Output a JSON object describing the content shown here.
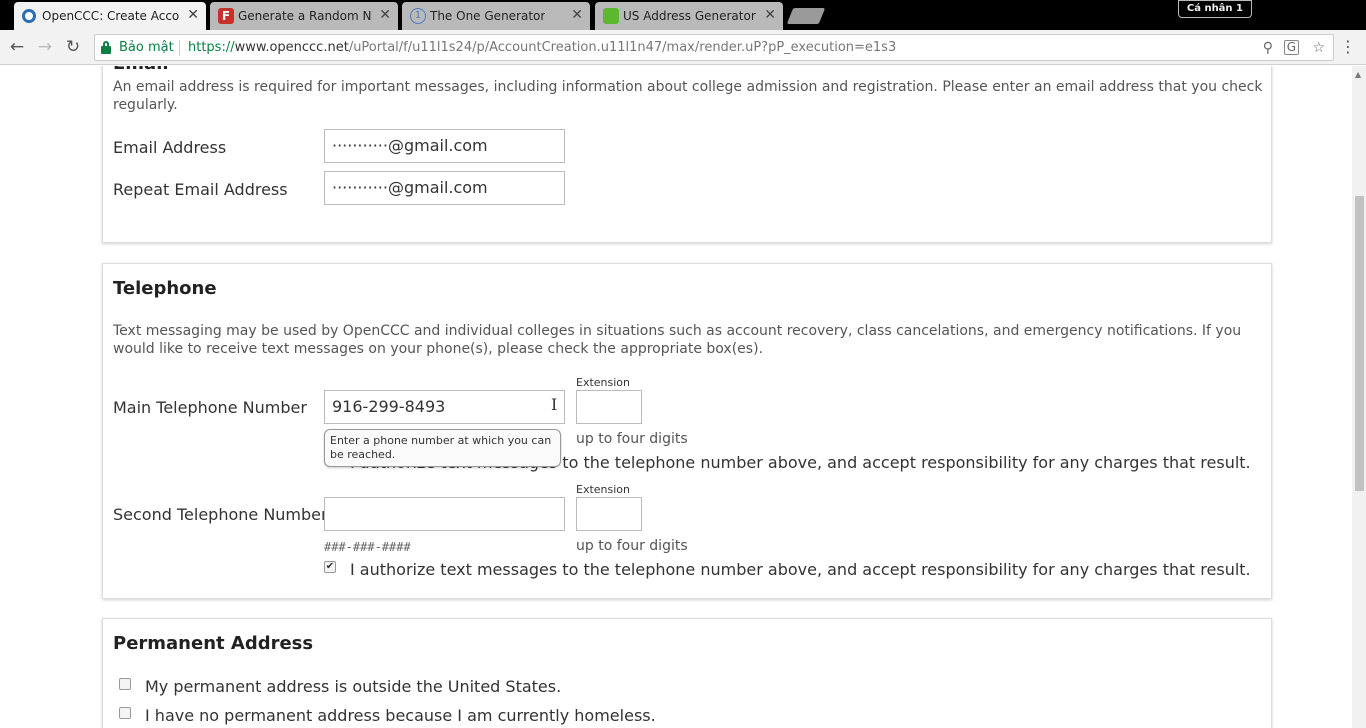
{
  "tabs": [
    {
      "title": "OpenCCC: Create Accour",
      "favicon": "openccc-icon",
      "active": true
    },
    {
      "title": "Generate a Random Nam",
      "favicon": "f-logo-icon",
      "active": false
    },
    {
      "title": "The One Generator",
      "favicon": "info-circle-icon",
      "active": false
    },
    {
      "title": "US Address Generator - F",
      "favicon": "map-pin-icon",
      "active": false
    }
  ],
  "tab_close_glyph": "✕",
  "profile_label": "Cá nhân 1",
  "toolbar": {
    "secure_label": "Bảo mật",
    "url_scheme": "https://",
    "url_host": "www.openccc.net",
    "url_path": "/uPortal/f/u11l1s24/p/AccountCreation.u11l1n47/max/render.uP?pP_execution=e1s3"
  },
  "email": {
    "title": "Email",
    "description": "An email address is required for important messages, including information about college admission and registration. Please enter an email address that you check regularly.",
    "email_label": "Email Address",
    "email_value": "···········@gmail.com",
    "repeat_label": "Repeat Email Address",
    "repeat_value": "···········@gmail.com"
  },
  "telephone": {
    "title": "Telephone",
    "description": "Text messaging may be used by OpenCCC and individual colleges in situations such as account recovery, class cancelations, and emergency notifications. If you would like to receive text messages on your phone(s), please check the appropriate box(es).",
    "main_label": "Main Telephone Number",
    "main_value": "916-299-8493",
    "extension_label": "Extension",
    "extension_hint": "up to four digits",
    "tooltip": "Enter a phone number at which you can be reached.",
    "authorize_text": "I authorize text messages to the telephone number above, and accept responsibility for any charges that result.",
    "second_label": "Second Telephone Number",
    "second_value": "",
    "format_hint": "###-###-####",
    "second_authorize_checked": true
  },
  "permanent_address": {
    "title": "Permanent Address",
    "outside_us_label": "My permanent address is outside the United States.",
    "homeless_label": "I have no permanent address because I am currently homeless."
  },
  "colors": {
    "secure_green": "#0b8043",
    "tab_active": "#f2f2f2",
    "tab_inactive": "#b9b9b9"
  }
}
